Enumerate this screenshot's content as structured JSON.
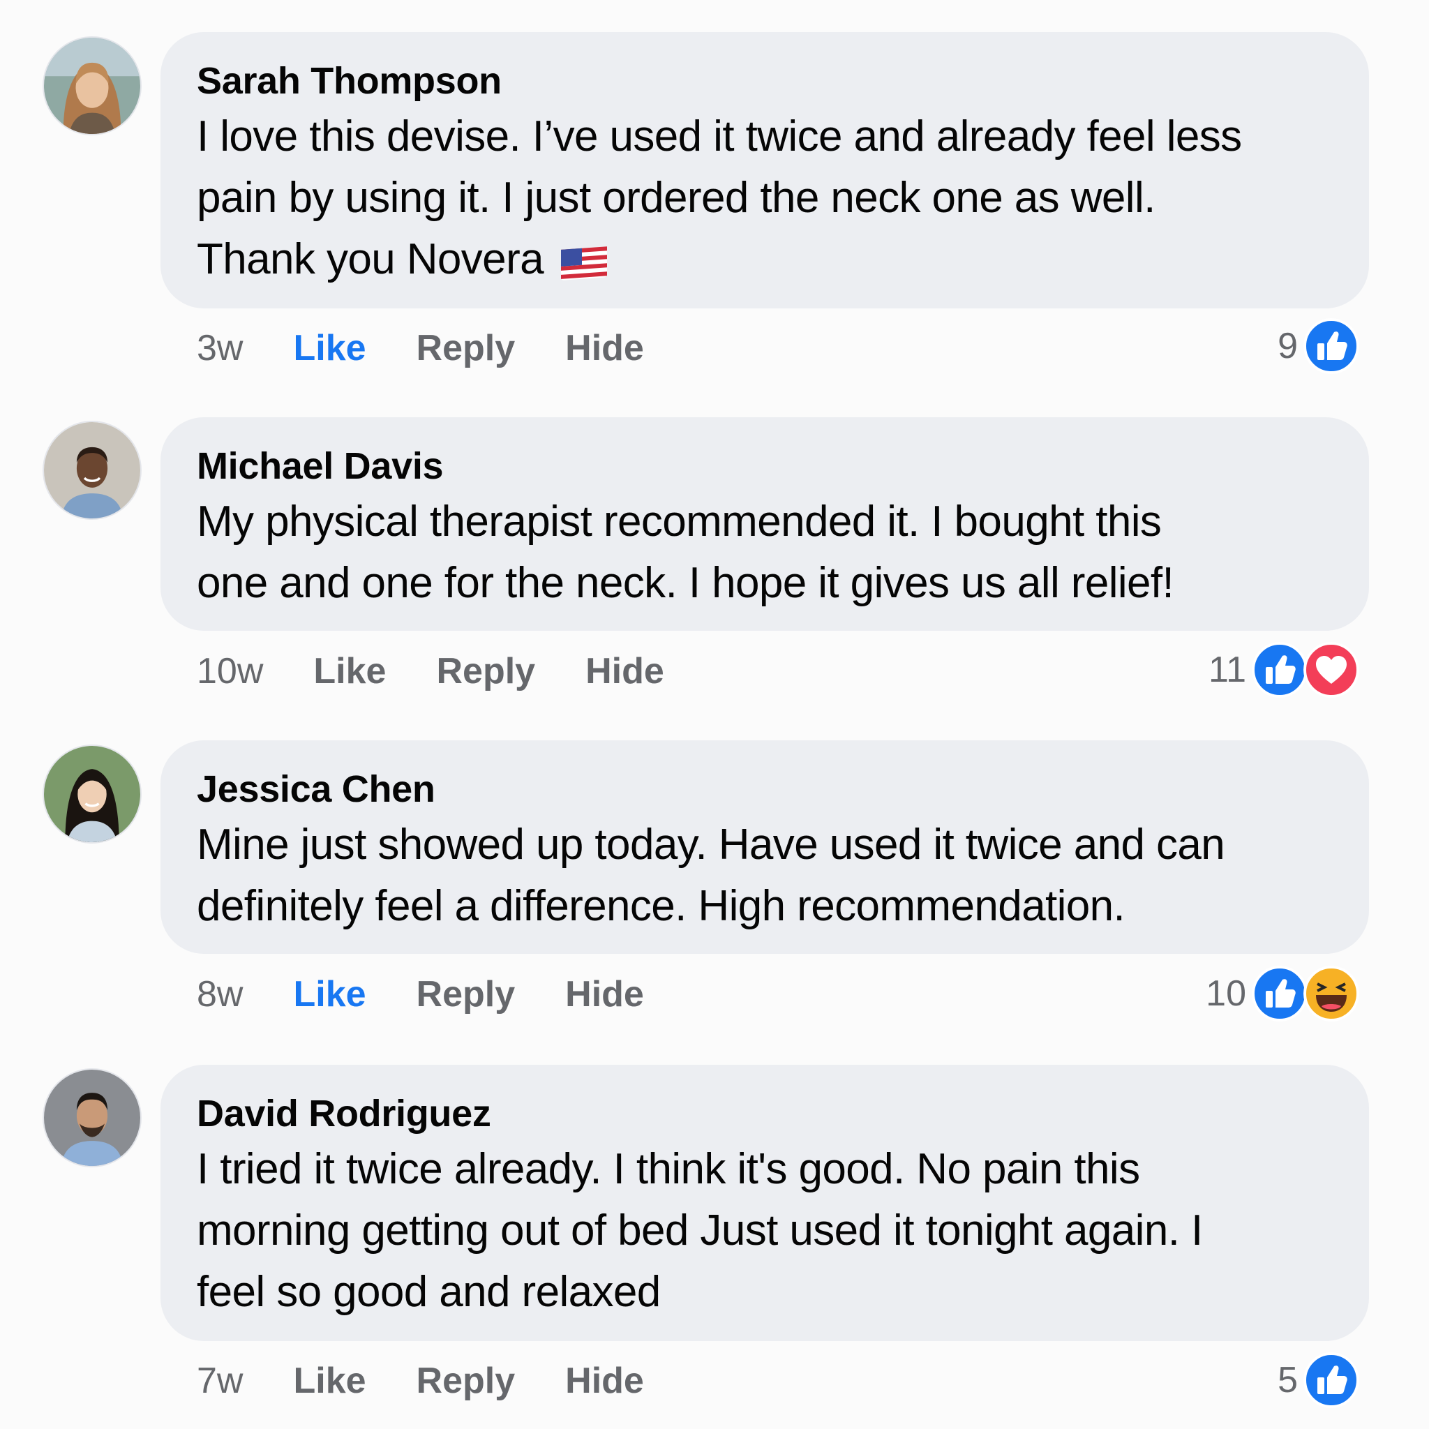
{
  "colors": {
    "bubble": "#eceef2",
    "meta_text": "#65676b",
    "like_blue": "#1877f2",
    "love_red": "#f33e58",
    "haha_yellow": "#f7b125"
  },
  "comments": [
    {
      "author": "Sarah Thompson",
      "lines": [
        "I love this devise. I’ve used it twice and already feel less",
        "pain by using it. I just ordered the neck one as well.",
        "Thank you Novera"
      ],
      "flag_icon": "us-flag-emoji",
      "time": "3w",
      "like_label": "Like",
      "liked": true,
      "reply_label": "Reply",
      "hide_label": "Hide",
      "reaction_count": "9",
      "reactions": [
        "like-icon"
      ]
    },
    {
      "author": "Michael Davis",
      "lines": [
        "My physical therapist recommended it. I bought this",
        "one and one for the neck. I hope it gives us all relief!"
      ],
      "time": "10w",
      "like_label": "Like",
      "liked": false,
      "reply_label": "Reply",
      "hide_label": "Hide",
      "reaction_count": "11",
      "reactions": [
        "like-icon",
        "love-icon"
      ]
    },
    {
      "author": "Jessica Chen",
      "lines": [
        "Mine just showed up today. Have used it twice and can",
        "definitely feel a difference. High recommendation."
      ],
      "time": "8w",
      "like_label": "Like",
      "liked": true,
      "reply_label": "Reply",
      "hide_label": "Hide",
      "reaction_count": "10",
      "reactions": [
        "like-icon",
        "haha-icon"
      ]
    },
    {
      "author": "David Rodriguez",
      "lines": [
        "I tried it twice already. I think it's good. No pain this",
        "morning getting out of bed Just used it tonight again. I",
        "feel so good and relaxed"
      ],
      "time": "7w",
      "like_label": "Like",
      "liked": false,
      "reply_label": "Reply",
      "hide_label": "Hide",
      "reaction_count": "5",
      "reactions": [
        "like-icon"
      ]
    }
  ]
}
